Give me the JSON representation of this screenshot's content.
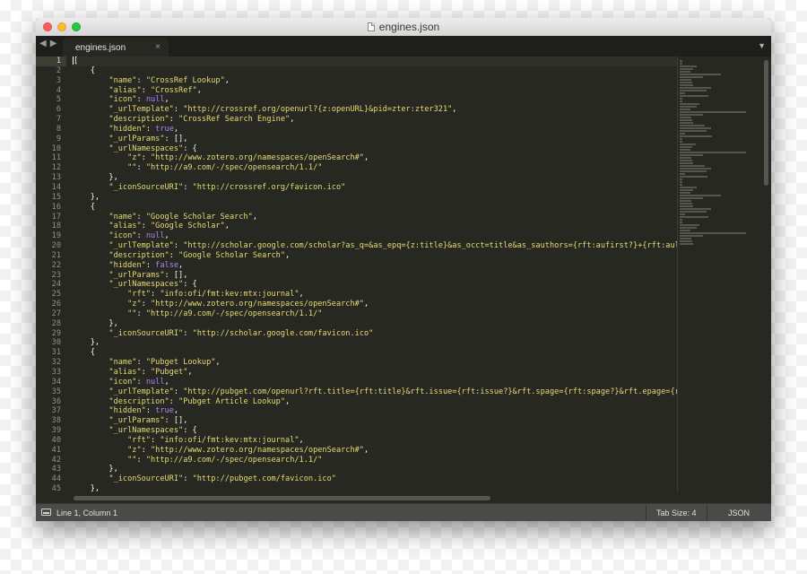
{
  "window": {
    "title": "engines.json"
  },
  "tab": {
    "label": "engines.json",
    "close": "×"
  },
  "nav": {
    "back": "◀",
    "forward": "▶"
  },
  "tab_dropdown": "▼",
  "status": {
    "position": "Line 1, Column 1",
    "tab_size": "Tab Size: 4",
    "syntax": "JSON"
  },
  "colors": {
    "background": "#272822",
    "string": "#e6db74",
    "constant": "#ae81ff",
    "text": "#f8f8f2",
    "gutter": "#8f908a"
  },
  "lines": [
    [
      [
        "t",
        "["
      ]
    ],
    [
      [
        "t",
        "    {"
      ]
    ],
    [
      [
        "t",
        "        "
      ],
      [
        "s",
        "\"name\""
      ],
      [
        "t",
        ": "
      ],
      [
        "s",
        "\"CrossRef Lookup\""
      ],
      [
        "t",
        ","
      ]
    ],
    [
      [
        "t",
        "        "
      ],
      [
        "s",
        "\"alias\""
      ],
      [
        "t",
        ": "
      ],
      [
        "s",
        "\"CrossRef\""
      ],
      [
        "t",
        ","
      ]
    ],
    [
      [
        "t",
        "        "
      ],
      [
        "s",
        "\"icon\""
      ],
      [
        "t",
        ": "
      ],
      [
        "c",
        "null"
      ],
      [
        "t",
        ","
      ]
    ],
    [
      [
        "t",
        "        "
      ],
      [
        "s",
        "\"_urlTemplate\""
      ],
      [
        "t",
        ": "
      ],
      [
        "s",
        "\"http://crossref.org/openurl?{z:openURL}&pid=zter:zter321\""
      ],
      [
        "t",
        ","
      ]
    ],
    [
      [
        "t",
        "        "
      ],
      [
        "s",
        "\"description\""
      ],
      [
        "t",
        ": "
      ],
      [
        "s",
        "\"CrossRef Search Engine\""
      ],
      [
        "t",
        ","
      ]
    ],
    [
      [
        "t",
        "        "
      ],
      [
        "s",
        "\"hidden\""
      ],
      [
        "t",
        ": "
      ],
      [
        "c",
        "true"
      ],
      [
        "t",
        ","
      ]
    ],
    [
      [
        "t",
        "        "
      ],
      [
        "s",
        "\"_urlParams\""
      ],
      [
        "t",
        ": [],"
      ]
    ],
    [
      [
        "t",
        "        "
      ],
      [
        "s",
        "\"_urlNamespaces\""
      ],
      [
        "t",
        ": {"
      ]
    ],
    [
      [
        "t",
        "            "
      ],
      [
        "s",
        "\"z\""
      ],
      [
        "t",
        ": "
      ],
      [
        "s",
        "\"http://www.zotero.org/namespaces/openSearch#\""
      ],
      [
        "t",
        ","
      ]
    ],
    [
      [
        "t",
        "            "
      ],
      [
        "s",
        "\"\""
      ],
      [
        "t",
        ": "
      ],
      [
        "s",
        "\"http://a9.com/-/spec/opensearch/1.1/\""
      ]
    ],
    [
      [
        "t",
        "        },"
      ]
    ],
    [
      [
        "t",
        "        "
      ],
      [
        "s",
        "\"_iconSourceURI\""
      ],
      [
        "t",
        ": "
      ],
      [
        "s",
        "\"http://crossref.org/favicon.ico\""
      ]
    ],
    [
      [
        "t",
        "    },"
      ]
    ],
    [
      [
        "t",
        "    {"
      ]
    ],
    [
      [
        "t",
        "        "
      ],
      [
        "s",
        "\"name\""
      ],
      [
        "t",
        ": "
      ],
      [
        "s",
        "\"Google Scholar Search\""
      ],
      [
        "t",
        ","
      ]
    ],
    [
      [
        "t",
        "        "
      ],
      [
        "s",
        "\"alias\""
      ],
      [
        "t",
        ": "
      ],
      [
        "s",
        "\"Google Scholar\""
      ],
      [
        "t",
        ","
      ]
    ],
    [
      [
        "t",
        "        "
      ],
      [
        "s",
        "\"icon\""
      ],
      [
        "t",
        ": "
      ],
      [
        "c",
        "null"
      ],
      [
        "t",
        ","
      ]
    ],
    [
      [
        "t",
        "        "
      ],
      [
        "s",
        "\"_urlTemplate\""
      ],
      [
        "t",
        ": "
      ],
      [
        "s",
        "\"http://scholar.google.com/scholar?as_q=&as_epq={z:title}&as_occt=title&as_sauthors={rft:aufirst?}+{rft:aulast"
      ]
    ],
    [
      [
        "t",
        "        "
      ],
      [
        "s",
        "\"description\""
      ],
      [
        "t",
        ": "
      ],
      [
        "s",
        "\"Google Scholar Search\""
      ],
      [
        "t",
        ","
      ]
    ],
    [
      [
        "t",
        "        "
      ],
      [
        "s",
        "\"hidden\""
      ],
      [
        "t",
        ": "
      ],
      [
        "c",
        "false"
      ],
      [
        "t",
        ","
      ]
    ],
    [
      [
        "t",
        "        "
      ],
      [
        "s",
        "\"_urlParams\""
      ],
      [
        "t",
        ": [],"
      ]
    ],
    [
      [
        "t",
        "        "
      ],
      [
        "s",
        "\"_urlNamespaces\""
      ],
      [
        "t",
        ": {"
      ]
    ],
    [
      [
        "t",
        "            "
      ],
      [
        "s",
        "\"rft\""
      ],
      [
        "t",
        ": "
      ],
      [
        "s",
        "\"info:ofi/fmt:kev:mtx:journal\""
      ],
      [
        "t",
        ","
      ]
    ],
    [
      [
        "t",
        "            "
      ],
      [
        "s",
        "\"z\""
      ],
      [
        "t",
        ": "
      ],
      [
        "s",
        "\"http://www.zotero.org/namespaces/openSearch#\""
      ],
      [
        "t",
        ","
      ]
    ],
    [
      [
        "t",
        "            "
      ],
      [
        "s",
        "\"\""
      ],
      [
        "t",
        ": "
      ],
      [
        "s",
        "\"http://a9.com/-/spec/opensearch/1.1/\""
      ]
    ],
    [
      [
        "t",
        "        },"
      ]
    ],
    [
      [
        "t",
        "        "
      ],
      [
        "s",
        "\"_iconSourceURI\""
      ],
      [
        "t",
        ": "
      ],
      [
        "s",
        "\"http://scholar.google.com/favicon.ico\""
      ]
    ],
    [
      [
        "t",
        "    },"
      ]
    ],
    [
      [
        "t",
        "    {"
      ]
    ],
    [
      [
        "t",
        "        "
      ],
      [
        "s",
        "\"name\""
      ],
      [
        "t",
        ": "
      ],
      [
        "s",
        "\"Pubget Lookup\""
      ],
      [
        "t",
        ","
      ]
    ],
    [
      [
        "t",
        "        "
      ],
      [
        "s",
        "\"alias\""
      ],
      [
        "t",
        ": "
      ],
      [
        "s",
        "\"Pubget\""
      ],
      [
        "t",
        ","
      ]
    ],
    [
      [
        "t",
        "        "
      ],
      [
        "s",
        "\"icon\""
      ],
      [
        "t",
        ": "
      ],
      [
        "c",
        "null"
      ],
      [
        "t",
        ","
      ]
    ],
    [
      [
        "t",
        "        "
      ],
      [
        "s",
        "\"_urlTemplate\""
      ],
      [
        "t",
        ": "
      ],
      [
        "s",
        "\"http://pubget.com/openurl?rft.title={rft:title}&rft.issue={rft:issue?}&rft.spage={rft:spage?}&rft.epage={rft:"
      ]
    ],
    [
      [
        "t",
        "        "
      ],
      [
        "s",
        "\"description\""
      ],
      [
        "t",
        ": "
      ],
      [
        "s",
        "\"Pubget Article Lookup\""
      ],
      [
        "t",
        ","
      ]
    ],
    [
      [
        "t",
        "        "
      ],
      [
        "s",
        "\"hidden\""
      ],
      [
        "t",
        ": "
      ],
      [
        "c",
        "true"
      ],
      [
        "t",
        ","
      ]
    ],
    [
      [
        "t",
        "        "
      ],
      [
        "s",
        "\"_urlParams\""
      ],
      [
        "t",
        ": [],"
      ]
    ],
    [
      [
        "t",
        "        "
      ],
      [
        "s",
        "\"_urlNamespaces\""
      ],
      [
        "t",
        ": {"
      ]
    ],
    [
      [
        "t",
        "            "
      ],
      [
        "s",
        "\"rft\""
      ],
      [
        "t",
        ": "
      ],
      [
        "s",
        "\"info:ofi/fmt:kev:mtx:journal\""
      ],
      [
        "t",
        ","
      ]
    ],
    [
      [
        "t",
        "            "
      ],
      [
        "s",
        "\"z\""
      ],
      [
        "t",
        ": "
      ],
      [
        "s",
        "\"http://www.zotero.org/namespaces/openSearch#\""
      ],
      [
        "t",
        ","
      ]
    ],
    [
      [
        "t",
        "            "
      ],
      [
        "s",
        "\"\""
      ],
      [
        "t",
        ": "
      ],
      [
        "s",
        "\"http://a9.com/-/spec/opensearch/1.1/\""
      ]
    ],
    [
      [
        "t",
        "        },"
      ]
    ],
    [
      [
        "t",
        "        "
      ],
      [
        "s",
        "\"_iconSourceURI\""
      ],
      [
        "t",
        ": "
      ],
      [
        "s",
        "\"http://pubget.com/favicon.ico\""
      ]
    ],
    [
      [
        "t",
        "    },"
      ]
    ]
  ]
}
